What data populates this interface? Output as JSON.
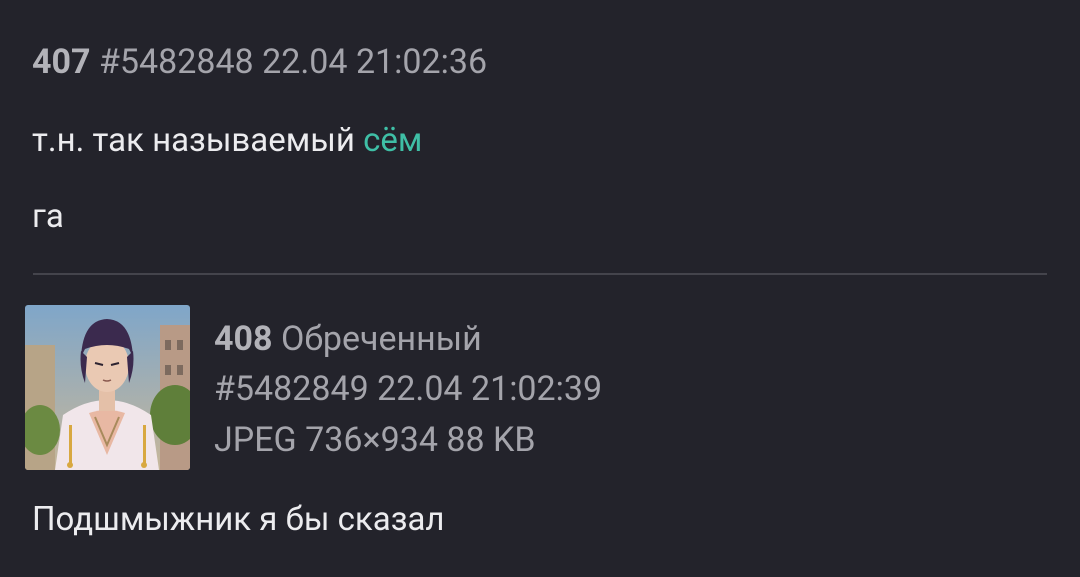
{
  "post1": {
    "number": "407",
    "post_id": "#5482848",
    "date": "22.04",
    "time": "21:02:36",
    "text_line1_prefix": "т.н. так называемый ",
    "text_line1_link": "сём",
    "text_line2": "га"
  },
  "post2": {
    "number": "408",
    "author": "Обреченный",
    "post_id": "#5482849",
    "date": "22.04",
    "time": "21:02:39",
    "file_format": "JPEG",
    "file_dimensions": "736×934",
    "file_size": "88 KB",
    "thumbnail_icon": "anime-character-thumbnail",
    "text": "Подшмыжник я бы сказал"
  },
  "colors": {
    "background": "#23232b",
    "meta_text": "#a4a4ab",
    "body_text": "#ececef",
    "link": "#3fbfa6",
    "divider": "#44444c"
  }
}
